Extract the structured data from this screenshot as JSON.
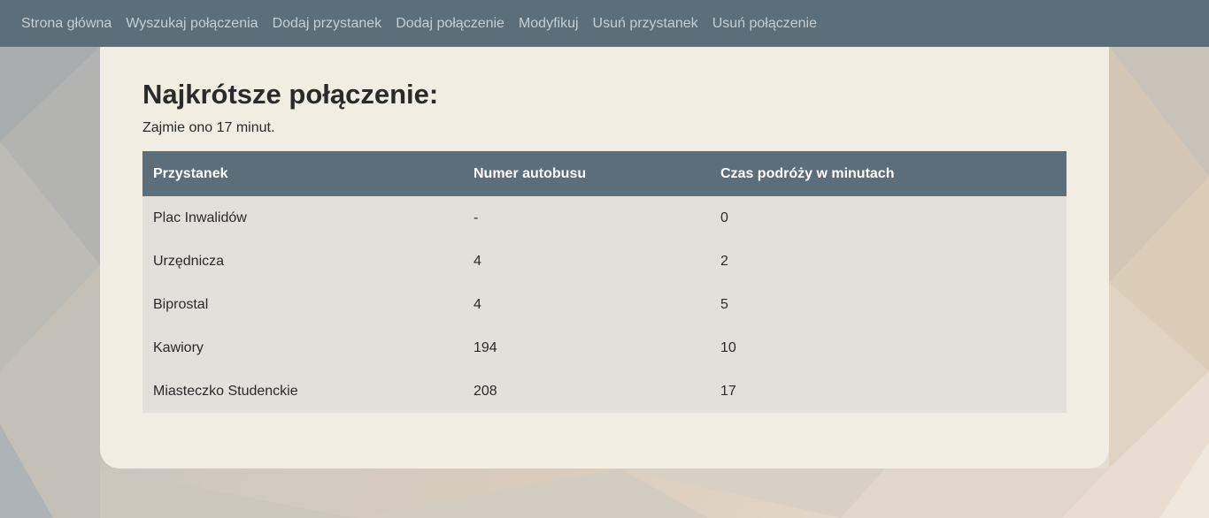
{
  "nav": {
    "items": [
      {
        "label": "Strona główna"
      },
      {
        "label": "Wyszukaj połączenia"
      },
      {
        "label": "Dodaj przystanek"
      },
      {
        "label": "Dodaj połączenie"
      },
      {
        "label": "Modyfikuj"
      },
      {
        "label": "Usuń przystanek"
      },
      {
        "label": "Usuń połączenie"
      }
    ]
  },
  "result": {
    "title": "Najkrótsze połączenie:",
    "summary": "Zajmie ono 17 minut."
  },
  "table": {
    "headers": [
      "Przystanek",
      "Numer autobusu",
      "Czas podróży w minutach"
    ],
    "rows": [
      [
        "Plac Inwalidów",
        "-",
        "0"
      ],
      [
        "Urzędnicza",
        "4",
        "2"
      ],
      [
        "Biprostal",
        "4",
        "5"
      ],
      [
        "Kawiory",
        "194",
        "10"
      ],
      [
        "Miasteczko Studenckie",
        "208",
        "17"
      ]
    ]
  },
  "colors": {
    "navbar": "#5b6e79",
    "nav_text": "#c5ced3",
    "card": "#f2ede2",
    "row": "#e3dfdb"
  }
}
